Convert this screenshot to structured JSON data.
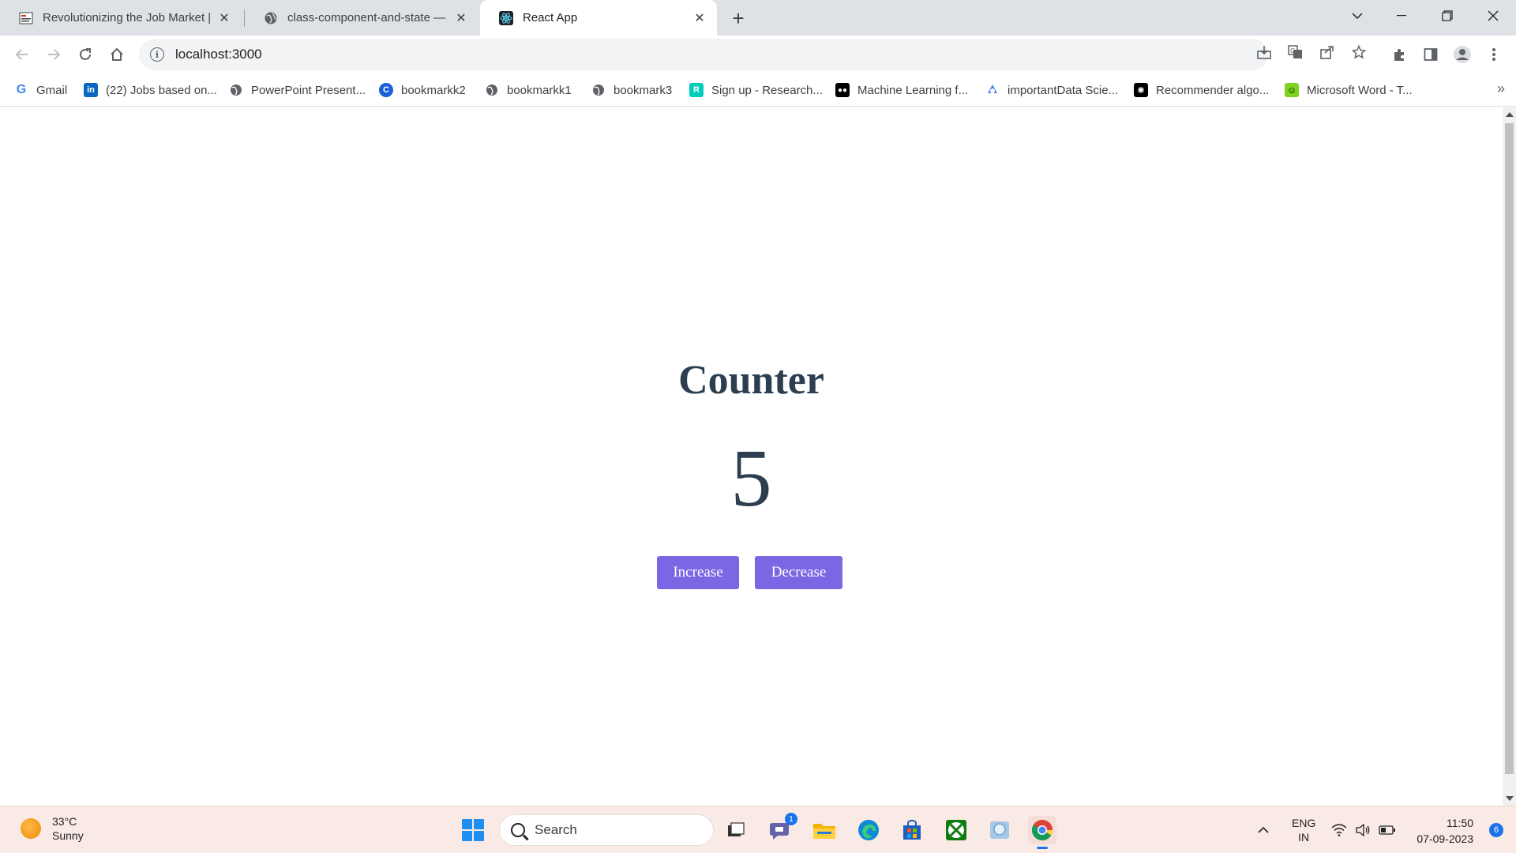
{
  "browser": {
    "tabs": [
      {
        "title": "Revolutionizing the Job Market |",
        "favicon": "news-favicon",
        "active": false
      },
      {
        "title": "class-component-and-state — C",
        "favicon": "globe-icon",
        "active": false
      },
      {
        "title": "React App",
        "favicon": "react-icon",
        "active": true
      }
    ],
    "address": "localhost:3000",
    "bookmarks": [
      {
        "label": "Gmail",
        "icon": "google-icon"
      },
      {
        "label": "(22) Jobs based on...",
        "icon": "linkedin-icon"
      },
      {
        "label": "PowerPoint Present...",
        "icon": "globe-icon"
      },
      {
        "label": "bookmarkk2",
        "icon": "c-icon"
      },
      {
        "label": "bookmarkk1",
        "icon": "globe-icon"
      },
      {
        "label": "bookmark3",
        "icon": "globe-icon"
      },
      {
        "label": "Sign up - Research...",
        "icon": "researchgate-icon"
      },
      {
        "label": "Machine Learning f...",
        "icon": "medium-icon"
      },
      {
        "label": "importantData Scie...",
        "icon": "drive-icon"
      },
      {
        "label": "Recommender algo...",
        "icon": "openai-icon"
      },
      {
        "label": "Microsoft Word - T...",
        "icon": "smiley-icon"
      }
    ],
    "bookmarks_more": "»"
  },
  "page": {
    "title": "Counter",
    "count": "5",
    "increase_label": "Increase",
    "decrease_label": "Decrease",
    "button_color": "#7a67e4",
    "text_color": "#2c3e50"
  },
  "taskbar": {
    "weather_temp": "33°C",
    "weather_desc": "Sunny",
    "search_label": "Search",
    "chat_badge": "1",
    "lang_top": "ENG",
    "lang_bottom": "IN",
    "time": "11:50",
    "date": "07-09-2023",
    "notifications": "6"
  }
}
